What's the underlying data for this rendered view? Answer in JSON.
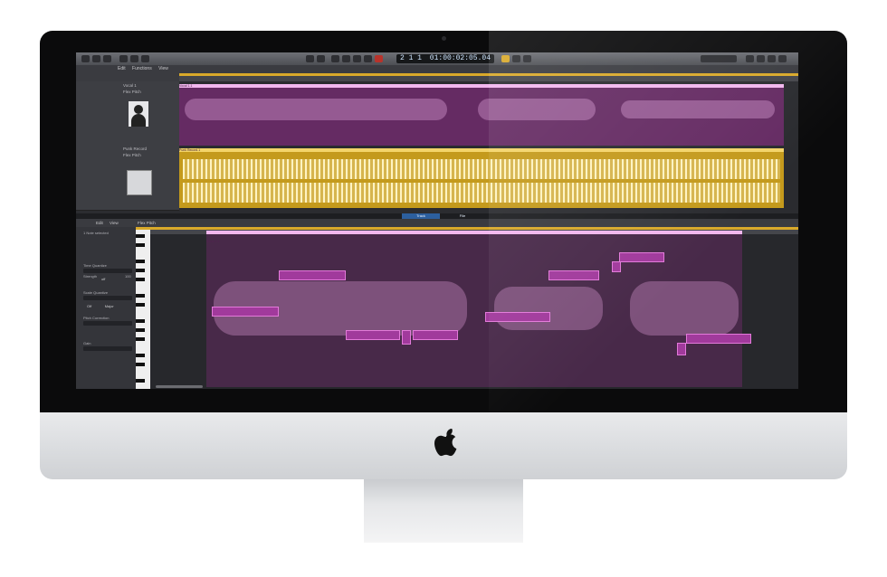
{
  "lcd": {
    "bars": "2 1 1",
    "time": "01:00:02:05.04"
  },
  "menu": {
    "edit": "Edit",
    "functions": "Functions",
    "view": "View"
  },
  "tracks": [
    {
      "name": "Vocal 1",
      "subtitle": "Flex Pitch",
      "region": "Vocal 1.1"
    },
    {
      "name": "Punk Record",
      "subtitle": "Flex Pitch",
      "region": "Punk Record.1"
    }
  ],
  "editor": {
    "tabs": [
      "Track",
      "File"
    ],
    "header_edit": "Edit",
    "header_view": "View",
    "header_mode": "Flex Pitch",
    "selection": "1 Note selected",
    "region_name": "Vocal 1.1",
    "inspector": {
      "time_quantize": "Time Quantize",
      "time_value": "off",
      "strength": "Strength",
      "strength_value": "100",
      "scale_quantize": "Scale Quantize",
      "scale_key": "Off",
      "scale_mode": "Major",
      "pitch_correction": "Pitch Correction",
      "gain": "Gain"
    }
  },
  "colors": {
    "purple": "#7a2c76",
    "yellow": "#c49a1c",
    "accent": "#d9a92a",
    "note": "#a13a9c"
  },
  "icons": [
    "apple-logo-icon",
    "transport-icon"
  ]
}
